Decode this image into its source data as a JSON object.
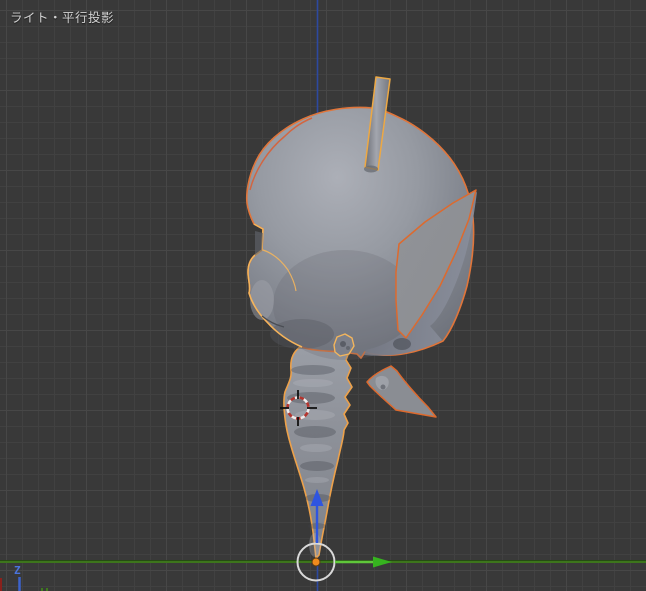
{
  "viewport": {
    "view_label": "ライト・平行投影",
    "mini_axis_z": "Z"
  },
  "colors": {
    "bg": "#393939",
    "grid_minor": "#414141",
    "grid_major": "#474747",
    "label_text": "#d2d2d2",
    "axis_y": "#3d751c",
    "axis_y_dark": "#234c0e",
    "axis_z": "#2d49a0",
    "arrow_y": "#36b31f",
    "arrow_y_stem": "#5fc73a",
    "arrow_z": "#2f55e0",
    "gizmo_circle": "#d9d9d9",
    "origin_orange": "#ef8a1d",
    "origin_rim": "#5a3a14",
    "cursor_red": "#b5342e",
    "cursor_white": "#ebebeb",
    "cursor_black": "#111111",
    "outline": "#e0753a",
    "outline_soft": "#f3b55c",
    "outline_red": "#d95f35",
    "outline_deep": "#dd6a2e",
    "antenna_outline": "#eda843",
    "body_outline": "#eda14a",
    "model_light": "#acafb7",
    "model_mid": "#8b8e96",
    "model_dark": "#70747d",
    "blade_grey": "#8b8d91",
    "z_label": "#4a74dd",
    "mini_axis_blue": "#3c63cc",
    "mini_axis_red": "#8a211c",
    "mini_axis_green": "#3f7a1e"
  }
}
